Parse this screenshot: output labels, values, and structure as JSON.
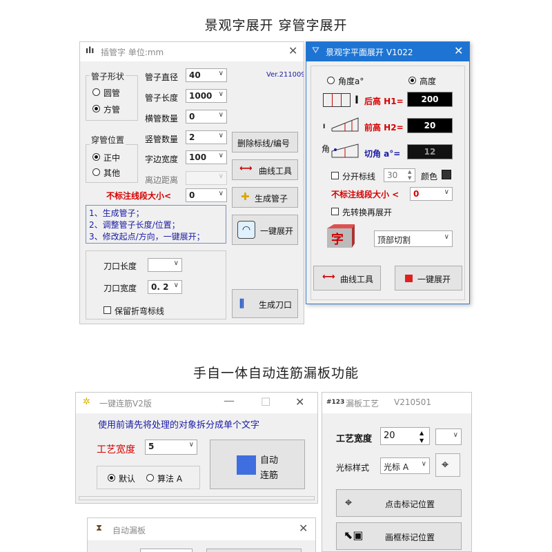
{
  "headings": {
    "top": "景观字展开  穿管字展开",
    "middle": "手自一体自动连筋漏板功能"
  },
  "pipe_window": {
    "title": "插管字 单位:mm",
    "version": "Ver.211009",
    "shape_group": "管子形状",
    "shape_round": "圆管",
    "shape_square": "方管",
    "pos_group": "穿管位置",
    "pos_center": "正中",
    "pos_other": "其他",
    "diameter_label": "管子直径",
    "diameter_value": "40",
    "length_label": "管子长度",
    "length_value": "1000",
    "hcount_label": "横管数量",
    "hcount_value": "0",
    "vcount_label": "竖管数量",
    "vcount_value": "2",
    "edge_width_label": "字边宽度",
    "edge_width_value": "100",
    "edge_dist_label": "离边距离",
    "edge_dist_value": "",
    "min_seg_label": "不标注线段大小<",
    "min_seg_value": "0",
    "btn_delete": "删除标线/编号",
    "btn_curve": "曲线工具",
    "btn_gen_pipe": "生成管子",
    "btn_expand": "一键展开",
    "btn_gen_blade": "生成刀口",
    "info_lines": [
      "1、生成管子；",
      "2、调整管子长度/位置；",
      "3、修改起点/方向，一键展开；"
    ],
    "blade_len_label": "刀口长度",
    "blade_len_value": "",
    "blade_width_label": "刀口宽度",
    "blade_width_value": "0. 2",
    "keep_fold": "保留折弯标线"
  },
  "land_window": {
    "title": "景观字平面展开 V1022",
    "angle_opt": "角度a°",
    "height_opt": "高度",
    "back_label": "后高 H1=",
    "back_value": "200",
    "front_label": "前高 H2=",
    "front_value": "20",
    "cut_prefix": "角",
    "cut_label": "切角 a°=",
    "cut_value": "12",
    "split_label": "分开标线",
    "split_value": "30",
    "color_label": "颜色",
    "min_seg_label": "不标注线段大小 <",
    "min_seg_value": "0",
    "convert_label": "先转换再展开",
    "cut_mode": "顶部切割",
    "btn_curve": "曲线工具",
    "btn_expand": "一键展开"
  },
  "rebar_window": {
    "title": "一键连筋V2版",
    "hint": "使用前请先将处理的对象拆分成单个文字",
    "width_label": "工艺宽度",
    "width_value": "5",
    "btn_auto_1": "自动",
    "btn_auto_2": "连筋",
    "opt_default": "默认",
    "opt_algo": "算法 A"
  },
  "leak_window": {
    "title": "漏板工艺",
    "version": "V210501",
    "icon_text": "#123",
    "width_label": "工艺宽度",
    "width_value": "20",
    "cursor_label": "光标样式",
    "cursor_value": "光标 A",
    "btn_click_mark": "点击标记位置",
    "btn_frame_mark": "画框标记位置"
  },
  "auto_window": {
    "title": "自动漏板"
  },
  "colors": {
    "accent": "#1e74d2",
    "red_label": "#d60000",
    "blue_label": "#1a1aa6",
    "auto_button": "#3f6ee0"
  }
}
